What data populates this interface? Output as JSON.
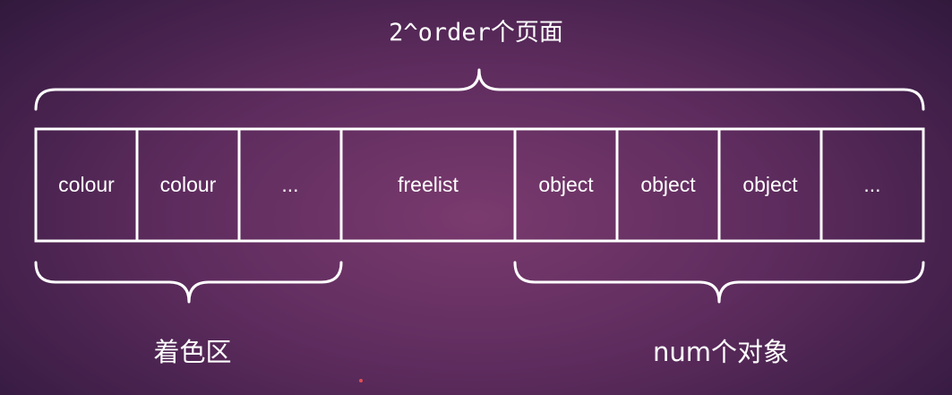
{
  "top_brace_label": "2^order个页面",
  "left_brace_label": "着色区",
  "right_brace_label": "num个对象",
  "cells": [
    "colour",
    "colour",
    "...",
    "freelist",
    "object",
    "object",
    "object",
    "..."
  ],
  "colors": {
    "background_center": "#7a3a6e",
    "background_edge": "#2e1839",
    "stroke": "#ffffff",
    "text": "#ffffff"
  }
}
